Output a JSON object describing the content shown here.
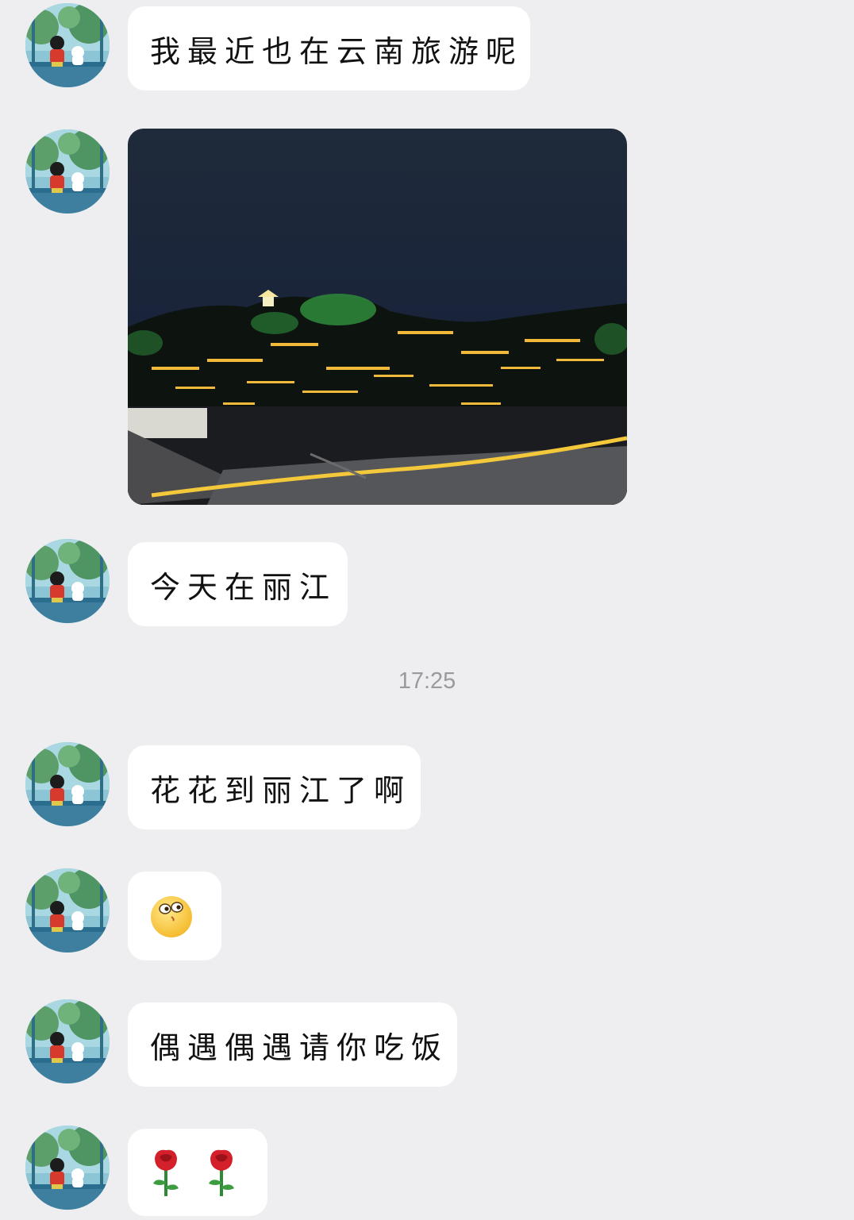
{
  "messages": [
    {
      "type": "text",
      "text": "我最近也在云南旅游呢"
    },
    {
      "type": "image",
      "icon": "night-town-photo"
    },
    {
      "type": "text",
      "text": "今天在丽江"
    },
    {
      "type": "text",
      "text": "花花到丽江了啊"
    },
    {
      "type": "sticker",
      "icon": "smiley-emoji"
    },
    {
      "type": "text",
      "text": "偶遇偶遇请你吃饭"
    },
    {
      "type": "sticker",
      "icon": "rose-emoji",
      "count": 2
    }
  ],
  "timestamp": "17:25",
  "colors": {
    "background": "#eeeef1",
    "bubble": "#ffffff",
    "timestamp": "#9a9a9e"
  }
}
